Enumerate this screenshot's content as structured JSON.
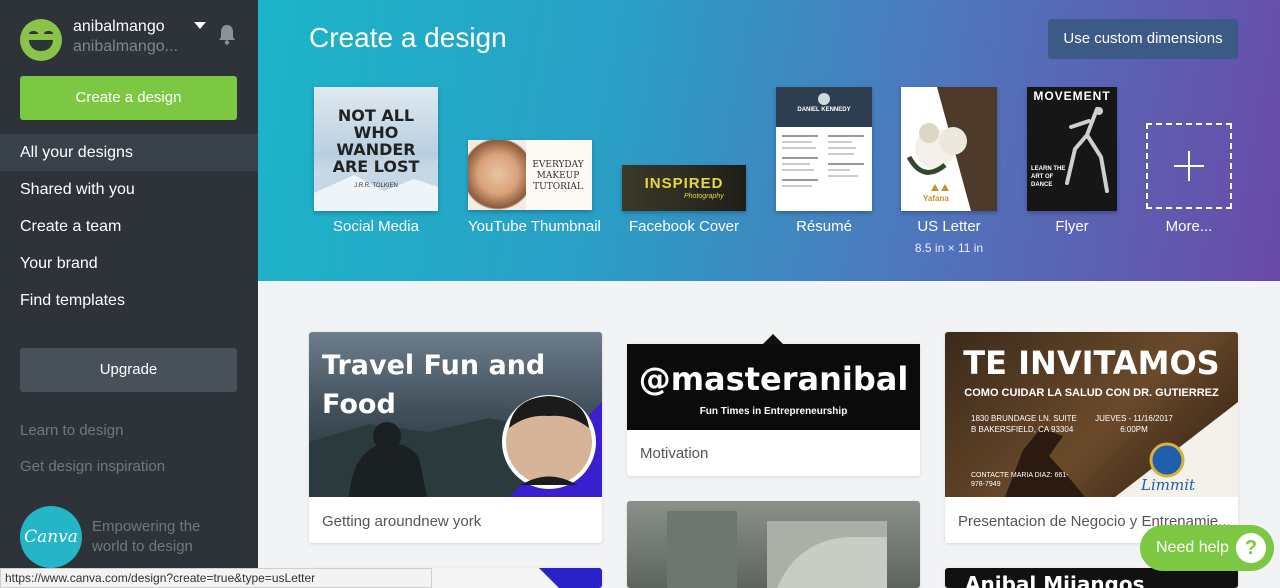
{
  "user": {
    "name": "anibalmango",
    "handle": "anibalmango..."
  },
  "sidebar": {
    "create_button": "Create a design",
    "nav": [
      "All your designs",
      "Shared with you",
      "Create a team",
      "Your brand",
      "Find templates"
    ],
    "upgrade_button": "Upgrade",
    "learn_link": "Learn to design",
    "inspiration_link": "Get design inspiration",
    "logo_text": "Canva",
    "tagline": "Empowering the world to design"
  },
  "header": {
    "title": "Create a design",
    "custom_dimensions_button": "Use custom dimensions",
    "templates": [
      {
        "label": "Social Media",
        "thumb_text": "NOT ALL WHO WANDER ARE LOST",
        "thumb_sub": "J.R.R. TOLKIEN"
      },
      {
        "label": "YouTube Thumbnail",
        "thumb_text": "EVERYDAY MAKEUP TUTORIAL"
      },
      {
        "label": "Facebook Cover",
        "thumb_text": "INSPIRED",
        "thumb_sub": "Photography"
      },
      {
        "label": "Résumé",
        "thumb_text": "DANIEL KENNEDY"
      },
      {
        "label": "US Letter",
        "sub": "8.5 in × 11 in",
        "thumb_text": "Yafana"
      },
      {
        "label": "Flyer",
        "thumb_text": "MOVEMENT",
        "thumb_sub": "LEARN THE ART OF DANCE"
      },
      {
        "label": "More..."
      }
    ]
  },
  "designs": [
    {
      "caption": "Getting aroundnew york",
      "title": "Travel Fun and Food"
    },
    {
      "caption": "Motivation",
      "title": "@masteranibal",
      "subtitle": "Fun Times in Entrepreneurship"
    },
    {
      "caption": "Presentacion de Negocio y Entrenamie...",
      "title": "TE INVITAMOS",
      "subtitle": "COMO CUIDAR LA SALUD CON DR. GUTIERREZ",
      "address": "1830 BRUNDAGE LN. SUITE B BAKERSFIELD, CA 93304",
      "date": "JUEVES - 11/16/2017 6:00PM",
      "contact": "CONTACTE MARIA DIAZ: 661-978-7949",
      "logo": "Limmit"
    },
    {
      "title": "Anibal Mijangos"
    }
  ],
  "status_url": "https://www.canva.com/design?create=true&type=usLetter",
  "help": {
    "label": "Need help",
    "icon": "?"
  }
}
